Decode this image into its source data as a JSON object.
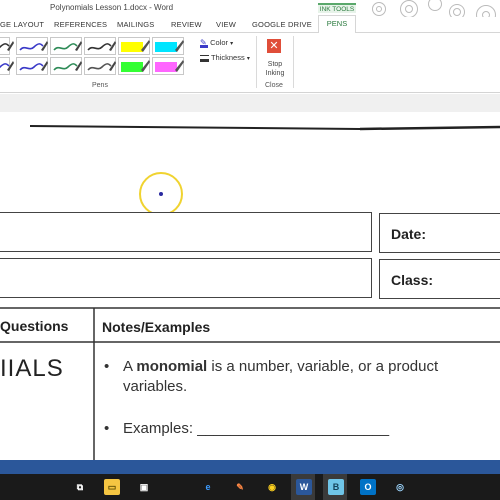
{
  "window": {
    "title": "Polynomials Lesson 1.docx - Word"
  },
  "ribbon": {
    "contextual_group": "INK TOOLS",
    "tabs": [
      {
        "label": "GE LAYOUT"
      },
      {
        "label": "REFERENCES"
      },
      {
        "label": "MAILINGS"
      },
      {
        "label": "REVIEW"
      },
      {
        "label": "VIEW"
      },
      {
        "label": "GOOGLE DRIVE"
      },
      {
        "label": "PENS",
        "active": true
      }
    ],
    "pens_group_label": "Pens",
    "color_label": "Color",
    "thickness_label": "Thickness",
    "stop_inking_label_1": "Stop",
    "stop_inking_label_2": "Inking",
    "close_group_label": "Close",
    "pen_swatches": [
      {
        "color": "#333333",
        "type": "pen"
      },
      {
        "color": "#3a3ac8",
        "type": "pen"
      },
      {
        "color": "#2e8b57",
        "type": "pen"
      },
      {
        "color": "#333333",
        "type": "pen"
      },
      {
        "color": "#ffff00",
        "type": "highlighter"
      },
      {
        "color": "#00e5ff",
        "type": "highlighter"
      },
      {
        "color": "#3a3ac8",
        "type": "pen"
      },
      {
        "color": "#3a3ac8",
        "type": "pen"
      },
      {
        "color": "#2e8b57",
        "type": "pen"
      },
      {
        "color": "#555555",
        "type": "pen"
      },
      {
        "color": "#33ff33",
        "type": "highlighter"
      },
      {
        "color": "#ff66ff",
        "type": "highlighter"
      }
    ]
  },
  "document": {
    "date_label": "Date:",
    "class_label": "Class:",
    "col_questions": "Questions",
    "col_notes": "Notes/Examples",
    "vocab_word": "IIALS",
    "bullet1_pre": "A ",
    "bullet1_bold": "monomial",
    "bullet1_post": " is a number, variable, or a product",
    "bullet1_line2": "variables.",
    "bullet2": "Examples: _______________________"
  },
  "taskbar": {
    "icons": [
      "task-view-icon",
      "file-explorer-icon",
      "store-icon",
      "edge-icon",
      "paint-icon",
      "chrome-icon",
      "word-icon",
      "ink-app-icon",
      "outlook-icon",
      "cortana-icon"
    ],
    "accent": "#2b579a"
  }
}
